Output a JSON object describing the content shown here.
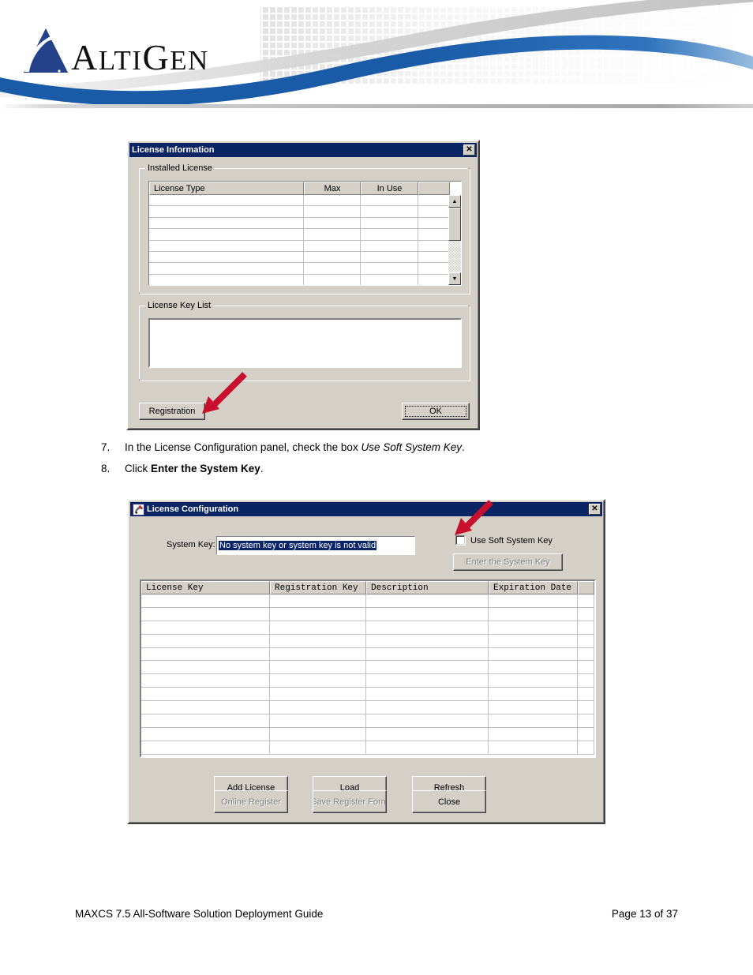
{
  "header": {
    "brand_name_parts": {
      "a": "A",
      "lti": "LTI",
      "g": "G",
      "en": "EN"
    },
    "brand_full": "ALTIGEN",
    "accent_blue": "#1a5ba8",
    "accent_gray": "#c9c9c9"
  },
  "dialog_license_information": {
    "title": "License Information",
    "close_label": "✕",
    "installed_license_group": "Installed License",
    "installed_table": {
      "columns": [
        "License Type",
        "Max",
        "In Use",
        ""
      ],
      "rows": [
        [
          "",
          "",
          "",
          ""
        ],
        [
          "",
          "",
          "",
          ""
        ],
        [
          "",
          "",
          "",
          ""
        ],
        [
          "",
          "",
          "",
          ""
        ],
        [
          "",
          "",
          "",
          ""
        ],
        [
          "",
          "",
          "",
          ""
        ],
        [
          "",
          "",
          "",
          ""
        ],
        [
          "",
          "",
          "",
          ""
        ]
      ]
    },
    "scrollbar": {
      "up_arrow": "▲",
      "down_arrow": "▼"
    },
    "license_key_list_group": "License Key List",
    "license_key_list_value": "",
    "registration_button": "Registration",
    "registration_button_accesskey": "R",
    "ok_button": "OK"
  },
  "steps": [
    {
      "number": "7.",
      "lead": "In the License Configuration panel, check the box ",
      "emphasis": "Use Soft System Key",
      "tail": "."
    },
    {
      "number": "8.",
      "lead": "Click ",
      "strong": "Enter the System Key",
      "tail": "."
    }
  ],
  "dialog_license_configuration": {
    "title": "License Configuration",
    "close_label": "✕",
    "system_key_label": "System Key:",
    "system_key_value": "No system key or system key is not valid",
    "use_soft_system_key_label": "Use Soft System Key",
    "use_soft_system_key_checked": false,
    "enter_system_key_button": "Enter the System Key",
    "enter_system_key_enabled": false,
    "license_table": {
      "columns": [
        "License Key",
        "Registration Key",
        "Description",
        "Expiration Date",
        ""
      ],
      "rows": [
        [
          "",
          "",
          "",
          "",
          ""
        ],
        [
          "",
          "",
          "",
          "",
          ""
        ],
        [
          "",
          "",
          "",
          "",
          ""
        ],
        [
          "",
          "",
          "",
          "",
          ""
        ],
        [
          "",
          "",
          "",
          "",
          ""
        ],
        [
          "",
          "",
          "",
          "",
          ""
        ],
        [
          "",
          "",
          "",
          "",
          ""
        ],
        [
          "",
          "",
          "",
          "",
          ""
        ],
        [
          "",
          "",
          "",
          "",
          ""
        ],
        [
          "",
          "",
          "",
          "",
          ""
        ],
        [
          "",
          "",
          "",
          "",
          ""
        ],
        [
          "",
          "",
          "",
          "",
          ""
        ]
      ]
    },
    "buttons": {
      "add_license": "Add License",
      "load": "Load",
      "refresh": "Refresh",
      "online_register": "Online Register",
      "save_register_form": "Save Register Form",
      "close": "Close"
    },
    "disabled_buttons": [
      "online_register",
      "save_register_form"
    ]
  },
  "footer": {
    "document_title": "MAXCS 7.5 All-Software Solution Deployment Guide",
    "page_number": "Page 13 of 37"
  },
  "annotations": {
    "arrow_color": "#c8102e",
    "arrow_1_target": "registration-button",
    "arrow_2_target": "use-soft-system-key-checkbox"
  }
}
